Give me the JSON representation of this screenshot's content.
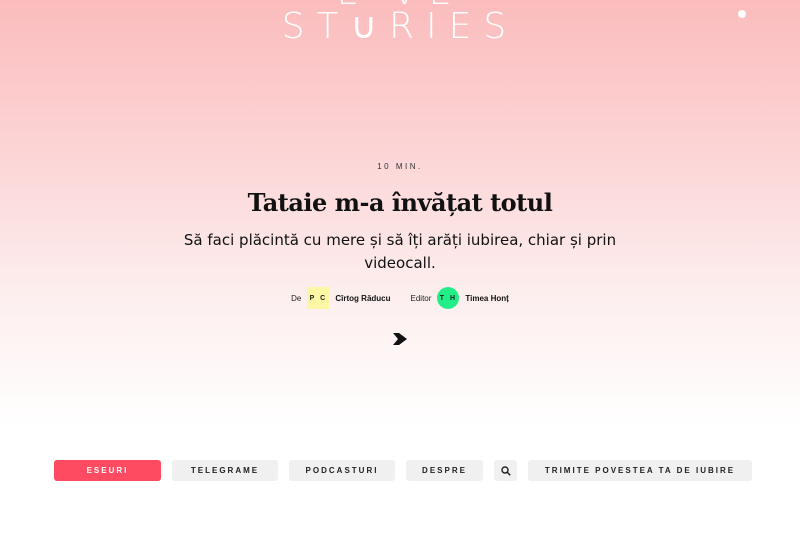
{
  "logo": {
    "line1": "L  VE",
    "line2": "ST∪RIES"
  },
  "article": {
    "reading_time": "10 MIN.",
    "title": "Tataie m-a învățat totul",
    "subtitle": "Să faci plăcintă cu mere și să îți arăți iubirea, chiar și prin videocall."
  },
  "credits": {
    "by_label": "De",
    "author_initials": "P C",
    "author_name": "Cîrtog Răducu",
    "editor_label": "Editor",
    "editor_initials": "T H",
    "editor_name": "Timea Honț"
  },
  "nav": {
    "eseuri": "ESEURI",
    "telegrame": "TELEGRAME",
    "podcasturi": "PODCASTURI",
    "despre": "DESPRE",
    "submit": "TRIMITE POVESTEA TA DE IUBIRE"
  },
  "colors": {
    "accent": "#ff4b62",
    "author_badge": "#fbf7a4",
    "editor_badge": "#22ee88"
  },
  "icons": {
    "arrow": "heart-arrow-icon",
    "search": "search-icon"
  }
}
